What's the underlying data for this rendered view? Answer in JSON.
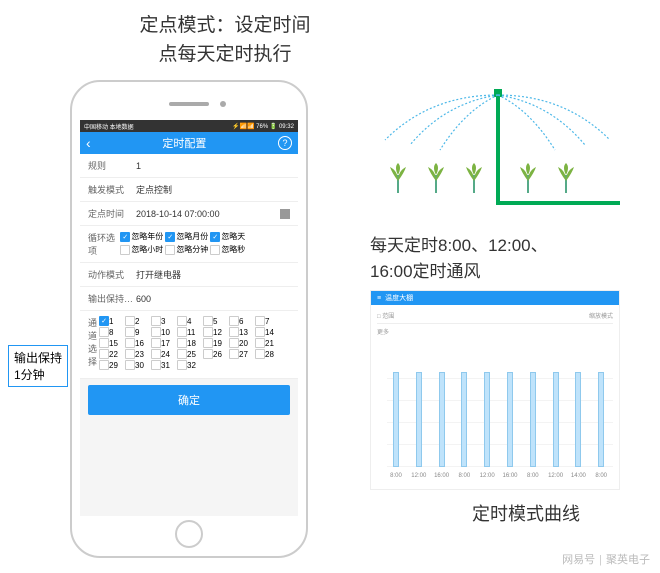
{
  "title_top": "定点模式：设定时间\n点每天定时执行",
  "callout": "输出保持\n1分钟",
  "status_bar": {
    "left": "中国移动  本地数据",
    "right": "⚡📶📶 76% 🔋 09:32"
  },
  "header": {
    "back": "‹",
    "title": "定时配置",
    "help": "?"
  },
  "form": {
    "rule_label": "规则",
    "rule_value": "1",
    "trigger_label": "触发模式",
    "trigger_value": "定点控制",
    "time_label": "定点时间",
    "time_value": "2018-10-14 07:00:00",
    "loop_label": "循环选项",
    "loop_options": [
      {
        "label": "忽略年份",
        "checked": true
      },
      {
        "label": "忽略月份",
        "checked": true
      },
      {
        "label": "忽略天",
        "checked": true
      },
      {
        "label": "忽略小时",
        "checked": false
      },
      {
        "label": "忽略分钟",
        "checked": false
      },
      {
        "label": "忽略秒",
        "checked": false
      }
    ],
    "action_label": "动作模式",
    "action_value": "打开继电器",
    "hold_label": "输出保持…",
    "hold_value": "600",
    "channel_label": "通道选择",
    "submit": "确定"
  },
  "channels": {
    "count": 32,
    "checked": [
      1
    ]
  },
  "schedule_text": "每天定时8:00、12:00、\n16:00定时通风",
  "chart_header": {
    "icon": "≡",
    "title": "温度大棚"
  },
  "chart_controls": {
    "range": "□ 范围",
    "scale": "缩放模式",
    "more": "更多"
  },
  "chart_caption": "定时模式曲线",
  "chart_data": {
    "type": "bar",
    "categories": [
      "8:00",
      "12:00",
      "16:00",
      "8:00",
      "12:00",
      "16:00",
      "8:00",
      "12:00",
      "14:00",
      "8:00"
    ],
    "values": [
      95,
      95,
      95,
      95,
      95,
      95,
      95,
      95,
      95,
      95
    ],
    "ylim": [
      0,
      100
    ]
  },
  "footer": {
    "brand": "网易号",
    "author": "聚英电子"
  }
}
